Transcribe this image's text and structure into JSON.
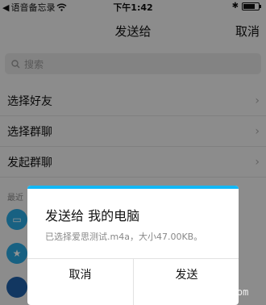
{
  "status_bar": {
    "back_app": "语音备忘录",
    "time": "下午1:42"
  },
  "nav": {
    "title": "发送给",
    "cancel": "取消"
  },
  "search": {
    "placeholder": "搜索"
  },
  "menu": {
    "items": [
      {
        "label": "选择好友"
      },
      {
        "label": "选择群聊"
      },
      {
        "label": "发起群聊"
      }
    ]
  },
  "recent": {
    "label": "最近"
  },
  "dialog": {
    "title": "发送给 我的电脑",
    "message": "已选择爱思测试.m4a，大小47.00KB。",
    "cancel": "取消",
    "send": "发送",
    "accent_color": "#12b7f5"
  },
  "watermark": "www.boledir.com",
  "icons": [
    "back-arrow-icon",
    "wifi-icon",
    "bluetooth-icon",
    "battery-icon",
    "search-icon",
    "chevron-right-icon",
    "computer-icon",
    "bookmark-icon"
  ]
}
